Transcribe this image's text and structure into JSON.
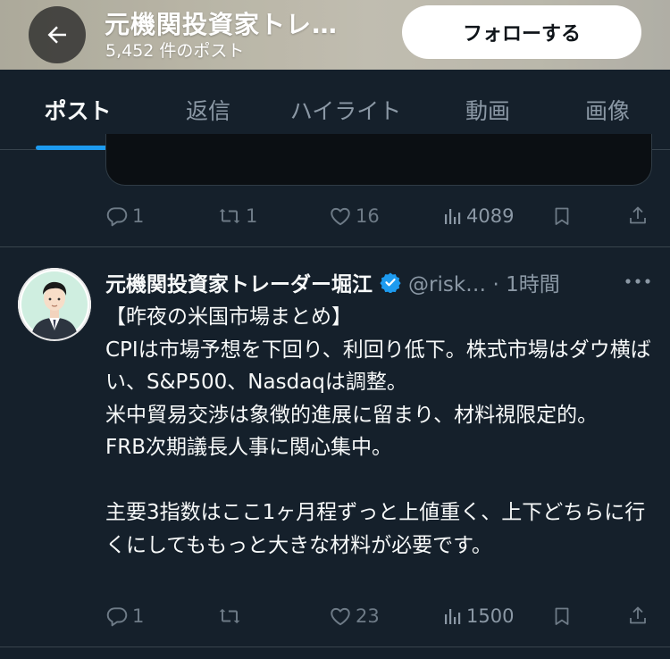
{
  "header": {
    "title": "元機関投資家トレ…",
    "subtitle": "5,452 件のポスト",
    "follow_label": "フォローする"
  },
  "tabs": [
    {
      "label": "ポスト",
      "active": true
    },
    {
      "label": "返信",
      "active": false
    },
    {
      "label": "ハイライト",
      "active": false
    },
    {
      "label": "動画",
      "active": false
    },
    {
      "label": "画像",
      "active": false
    }
  ],
  "previous_post": {
    "replies": "1",
    "reposts": "1",
    "likes": "16",
    "views": "4089"
  },
  "post": {
    "author_name": "元機関投資家トレーダー堀江",
    "handle_time": "@risk… · 1時間",
    "text": "【昨夜の米国市場まとめ】\nCPIは市場予想を下回り、利回り低下。株式市場はダウ横ばい、S&P500、Nasdaqは調整。\n米中貿易交渉は象徴的進展に留まり、材料視限定的。\nFRB次期議長人事に関心集中。\n\n主要3指数はここ1ヶ月程ずっと上値重く、上下どちらに行くにしてももっと大きな材料が必要です。",
    "replies": "1",
    "reposts": "",
    "likes": "23",
    "views": "1500"
  },
  "colors": {
    "background": "#15202b",
    "accent": "#1d9bf0",
    "secondary_text": "#8b98a5",
    "divider": "#38444d"
  },
  "icons": [
    "back-arrow-icon",
    "reply-icon",
    "repost-icon",
    "like-icon",
    "views-icon",
    "bookmark-icon",
    "share-icon",
    "verified-badge-icon",
    "more-icon"
  ]
}
